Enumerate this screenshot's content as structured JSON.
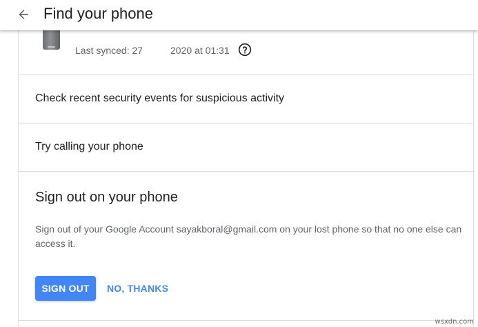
{
  "header": {
    "title": "Find your phone",
    "back_icon": "arrow-back-icon"
  },
  "device": {
    "icon": "phone-icon",
    "synced_label": "Last synced: 27",
    "synced_date": "2020 at 01:31",
    "help_icon": "help-circle-icon"
  },
  "security": {
    "label": "Check recent security events for suspicious activity"
  },
  "call": {
    "label": "Try calling your phone"
  },
  "sign_out": {
    "title": "Sign out on your phone",
    "description": "Sign out of your Google Account sayakboral@gmail.com on your lost phone so that no one else can access it.",
    "sign_out_label": "SIGN OUT",
    "no_thanks_label": "NO, THANKS"
  },
  "colors": {
    "accent": "#4285f4",
    "divider": "#dadce0",
    "secondary_text": "#5f6368"
  },
  "watermark": "wsxdn.com"
}
